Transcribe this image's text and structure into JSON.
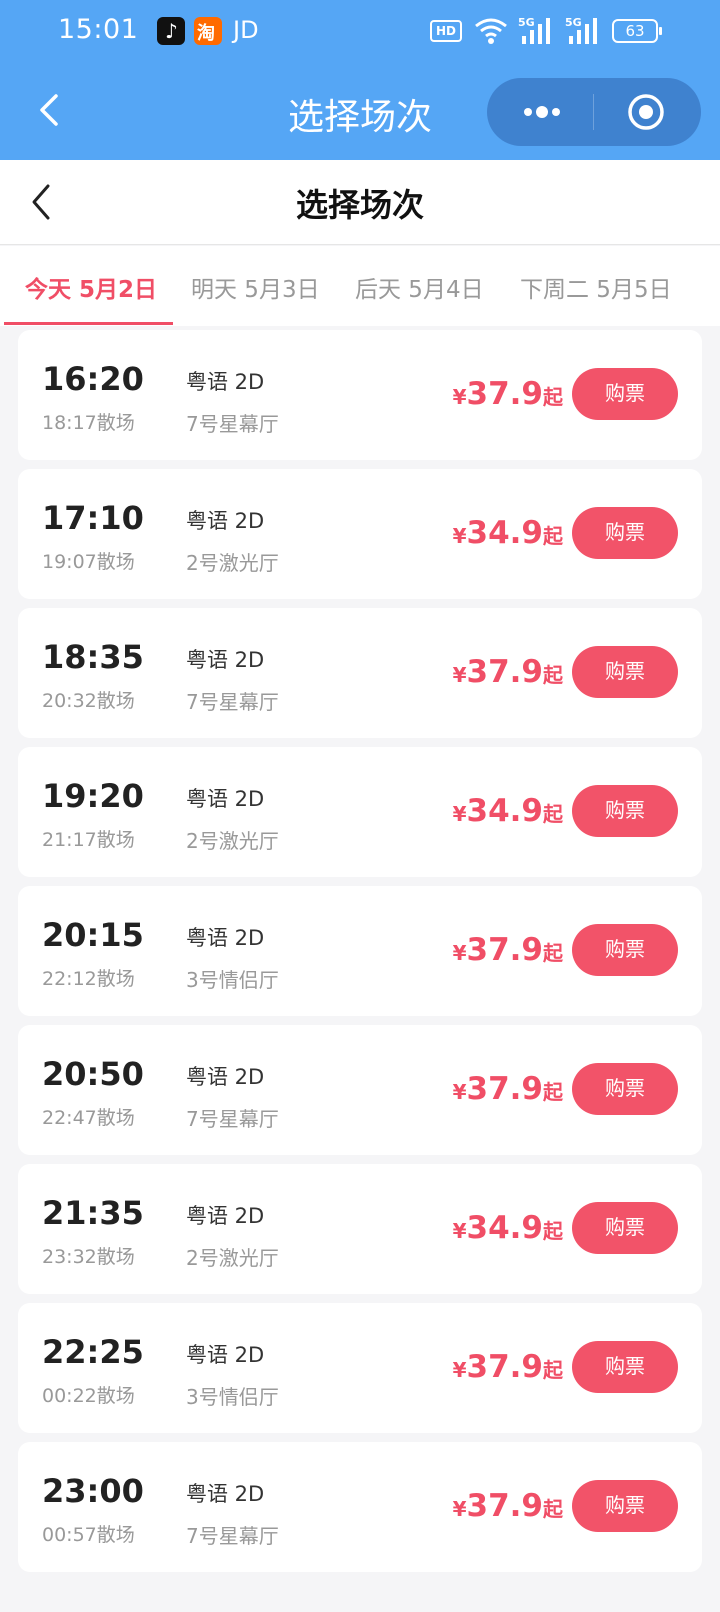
{
  "status_bar": {
    "time": "15:01",
    "carrier_app": "JD",
    "network_badge": "HD",
    "signal_label": "5G",
    "battery": "63"
  },
  "header": {
    "title": "选择场次"
  },
  "page": {
    "title": "选择场次"
  },
  "tabs": [
    {
      "label": "今天 5月2日",
      "active": true
    },
    {
      "label": "明天 5月3日",
      "active": false
    },
    {
      "label": "后天 5月4日",
      "active": false
    },
    {
      "label": "下周二 5月5日",
      "active": false
    }
  ],
  "showtimes": [
    {
      "start": "16:20",
      "end": "18:17散场",
      "lang": "粤语 2D",
      "hall": "7号星幕厅",
      "currency": "¥",
      "price": "37.9",
      "suffix": "起",
      "button": "购票"
    },
    {
      "start": "17:10",
      "end": "19:07散场",
      "lang": "粤语 2D",
      "hall": "2号激光厅",
      "currency": "¥",
      "price": "34.9",
      "suffix": "起",
      "button": "购票"
    },
    {
      "start": "18:35",
      "end": "20:32散场",
      "lang": "粤语 2D",
      "hall": "7号星幕厅",
      "currency": "¥",
      "price": "37.9",
      "suffix": "起",
      "button": "购票"
    },
    {
      "start": "19:20",
      "end": "21:17散场",
      "lang": "粤语 2D",
      "hall": "2号激光厅",
      "currency": "¥",
      "price": "34.9",
      "suffix": "起",
      "button": "购票"
    },
    {
      "start": "20:15",
      "end": "22:12散场",
      "lang": "粤语 2D",
      "hall": "3号情侣厅",
      "currency": "¥",
      "price": "37.9",
      "suffix": "起",
      "button": "购票"
    },
    {
      "start": "20:50",
      "end": "22:47散场",
      "lang": "粤语 2D",
      "hall": "7号星幕厅",
      "currency": "¥",
      "price": "37.9",
      "suffix": "起",
      "button": "购票"
    },
    {
      "start": "21:35",
      "end": "23:32散场",
      "lang": "粤语 2D",
      "hall": "2号激光厅",
      "currency": "¥",
      "price": "34.9",
      "suffix": "起",
      "button": "购票"
    },
    {
      "start": "22:25",
      "end": "00:22散场",
      "lang": "粤语 2D",
      "hall": "3号情侣厅",
      "currency": "¥",
      "price": "37.9",
      "suffix": "起",
      "button": "购票"
    },
    {
      "start": "23:00",
      "end": "00:57散场",
      "lang": "粤语 2D",
      "hall": "7号星幕厅",
      "currency": "¥",
      "price": "37.9",
      "suffix": "起",
      "button": "购票"
    }
  ],
  "colors": {
    "header_blue": "#55a6f5",
    "accent_red": "#f04e66",
    "button_red": "#f25369"
  },
  "icons": [
    "tiktok-icon",
    "taobao-icon",
    "wifi-icon",
    "signal-icon",
    "battery-icon",
    "back-arrow-icon",
    "more-dots-icon",
    "target-icon"
  ]
}
